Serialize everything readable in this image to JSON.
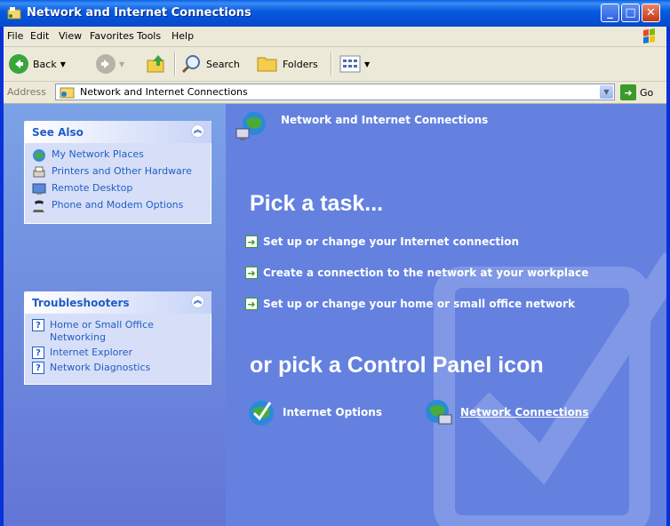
{
  "window": {
    "title": "Network and Internet Connections"
  },
  "menu": [
    "File",
    "Edit",
    "View",
    "Favorites",
    "Tools",
    "Help"
  ],
  "toolbar": {
    "back": "Back",
    "search": "Search",
    "folders": "Folders"
  },
  "address": {
    "label": "Address",
    "value": "Network and Internet Connections",
    "go": "Go"
  },
  "see_also": {
    "title": "See Also",
    "items": [
      "My Network Places",
      "Printers and Other Hardware",
      "Remote Desktop",
      "Phone and Modem Options"
    ]
  },
  "troubleshooters": {
    "title": "Troubleshooters",
    "items": [
      "Home or Small Office Networking",
      "Internet Explorer",
      "Network Diagnostics"
    ]
  },
  "main": {
    "header": "Network and Internet Connections",
    "pick_task": "Pick a task...",
    "tasks": [
      "Set up or change your Internet connection",
      "Create a connection to the network at your workplace",
      "Set up or change your home or small office network"
    ],
    "pick_icon": "or pick a Control Panel icon",
    "icons": [
      "Internet Options",
      "Network Connections"
    ]
  },
  "colors": {
    "accent": "#215dc6",
    "pane": "#6481e0",
    "title": "#0550d8"
  }
}
